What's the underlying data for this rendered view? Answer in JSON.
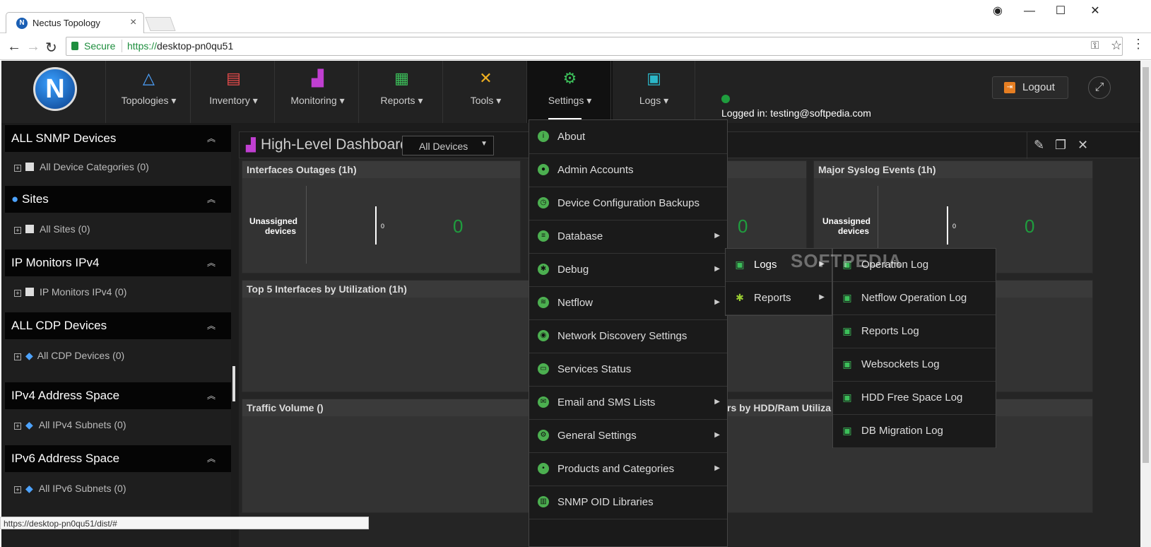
{
  "browser": {
    "tab_title": "Nectus Topology",
    "secure_label": "Secure",
    "url_scheme": "https://",
    "url_host": "desktop-pn0qu51",
    "status_url": "https://desktop-pn0qu51/dist/#"
  },
  "header": {
    "logo": "N",
    "nav": [
      {
        "label": "Topologies ▾",
        "icon": "topology-icon"
      },
      {
        "label": "Inventory ▾",
        "icon": "inventory-icon"
      },
      {
        "label": "Monitoring ▾",
        "icon": "monitoring-icon"
      },
      {
        "label": "Reports ▾",
        "icon": "reports-icon"
      },
      {
        "label": "Tools ▾",
        "icon": "tools-icon"
      },
      {
        "label": "Settings ▾",
        "icon": "gear-icon"
      },
      {
        "label": "Logs ▾",
        "icon": "logs-icon"
      }
    ],
    "logged_in": "Logged in: testing@softpedia.com",
    "logout": "Logout"
  },
  "sidebar": {
    "sections": [
      {
        "title": "ALL SNMP Devices",
        "item": "All Device Categories (0)"
      },
      {
        "title": "Sites",
        "item": "All Sites (0)"
      },
      {
        "title": "IP Monitors IPv4",
        "item": "IP Monitors IPv4 (0)"
      },
      {
        "title": "ALL CDP Devices",
        "item": "All CDP Devices (0)"
      },
      {
        "title": "IPv4 Address Space",
        "item": "All IPv4 Subnets (0)"
      },
      {
        "title": "IPv6 Address Space",
        "item": "All IPv6 Subnets (0)"
      }
    ]
  },
  "dashboard": {
    "title": "High-Level Dashboard",
    "filter": "All Devices",
    "panels": {
      "outages": "Interfaces Outages (1h)",
      "syslog": "Major Syslog Events (1h)",
      "top5": "Top 5 Interfaces by Utilization (1h)",
      "traffic": "Traffic Volume ()",
      "hdd": "rs by HDD/Ram Utiliza"
    },
    "unassigned": "Unassigned devices",
    "zero": "0"
  },
  "settings_menu": [
    {
      "label": "About",
      "sub": false
    },
    {
      "label": "Admin Accounts",
      "sub": false
    },
    {
      "label": "Device Configuration Backups",
      "sub": false
    },
    {
      "label": "Database",
      "sub": true
    },
    {
      "label": "Debug",
      "sub": true
    },
    {
      "label": "Netflow",
      "sub": true
    },
    {
      "label": "Network Discovery Settings",
      "sub": false
    },
    {
      "label": "Services Status",
      "sub": false
    },
    {
      "label": "Email and SMS Lists",
      "sub": true
    },
    {
      "label": "General Settings",
      "sub": true
    },
    {
      "label": "Products and Categories",
      "sub": true
    },
    {
      "label": "SNMP OID Libraries",
      "sub": false
    }
  ],
  "debug_submenu": [
    {
      "label": "Logs"
    },
    {
      "label": "Reports"
    }
  ],
  "logs_submenu": [
    {
      "label": "Operation Log"
    },
    {
      "label": "Netflow Operation Log"
    },
    {
      "label": "Reports Log"
    },
    {
      "label": "Websockets Log"
    },
    {
      "label": "HDD Free Space Log"
    },
    {
      "label": "DB Migration Log"
    }
  ],
  "watermark": "SOFTPEDIA"
}
